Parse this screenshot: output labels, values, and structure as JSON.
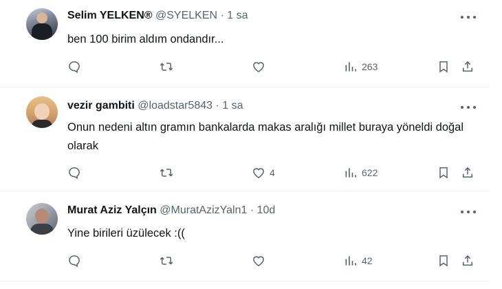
{
  "tweets": [
    {
      "name": "Selim YELKEN®",
      "handle": "@SYELKEN",
      "time": "1 sa",
      "text": "ben 100 birim aldım ondandır...",
      "likes": "",
      "views": "263"
    },
    {
      "name": "vezir gambiti",
      "handle": "@loadstar5843",
      "time": "1 sa",
      "text": "Onun nedeni altın gramın bankalarda makas aralığı millet buraya yöneldi doğal olarak",
      "likes": "4",
      "views": "622"
    },
    {
      "name": "Murat Aziz Yalçın",
      "handle": "@MuratAzizYaln1",
      "time": "10d",
      "text": "Yine birileri üzülecek :((",
      "likes": "",
      "views": "42"
    }
  ],
  "separator": "·",
  "icons": {
    "reply": "reply-icon",
    "retweet": "retweet-icon",
    "like": "heart-icon",
    "views": "views-chart-icon",
    "bookmark": "bookmark-icon",
    "share": "share-icon",
    "more": "more-dots-icon"
  },
  "colors": {
    "name": "#0f1419",
    "secondary": "#536471",
    "divider": "#eff3f4"
  }
}
